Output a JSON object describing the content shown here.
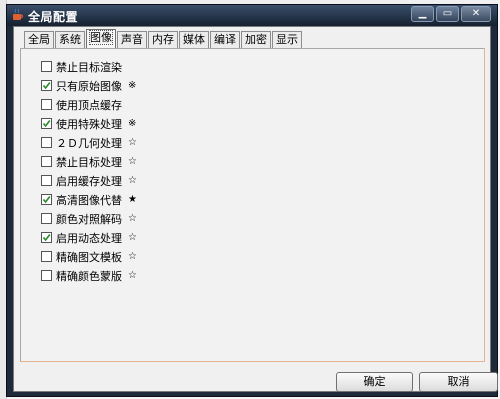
{
  "window": {
    "title": "全局配置",
    "minimize_icon": "minimize-icon",
    "maximize_icon": "maximize-icon",
    "close_icon": "close-icon",
    "app_icon": "java-cup-icon"
  },
  "tabs": [
    {
      "label": "全局",
      "active": false
    },
    {
      "label": "系统",
      "active": false
    },
    {
      "label": "图像",
      "active": true
    },
    {
      "label": "声音",
      "active": false
    },
    {
      "label": "内存",
      "active": false
    },
    {
      "label": "媒体",
      "active": false
    },
    {
      "label": "编译",
      "active": false
    },
    {
      "label": "加密",
      "active": false
    },
    {
      "label": "显示",
      "active": false
    }
  ],
  "options": [
    {
      "label": "禁止目标渲染",
      "checked": false,
      "mark": ""
    },
    {
      "label": "只有原始图像",
      "checked": true,
      "mark": "※"
    },
    {
      "label": "使用顶点缓存",
      "checked": false,
      "mark": ""
    },
    {
      "label": "使用特殊处理",
      "checked": true,
      "mark": "※"
    },
    {
      "label": "２Ｄ几何处理",
      "checked": false,
      "mark": "☆"
    },
    {
      "label": "禁止目标处理",
      "checked": false,
      "mark": "☆"
    },
    {
      "label": "启用缓存处理",
      "checked": false,
      "mark": "☆"
    },
    {
      "label": "高清图像代替",
      "checked": true,
      "mark": "★"
    },
    {
      "label": "颜色对照解码",
      "checked": false,
      "mark": "☆"
    },
    {
      "label": "启用动态处理",
      "checked": true,
      "mark": "☆"
    },
    {
      "label": "精确图文模板",
      "checked": false,
      "mark": "☆"
    },
    {
      "label": "精确颜色蒙版",
      "checked": false,
      "mark": "☆"
    }
  ],
  "buttons": {
    "ok": "确定",
    "cancel": "取消"
  },
  "colors": {
    "titlebar": "#1e2a3a",
    "panel_border_accent": "#e4b38f",
    "check": "#2a8a2a"
  }
}
